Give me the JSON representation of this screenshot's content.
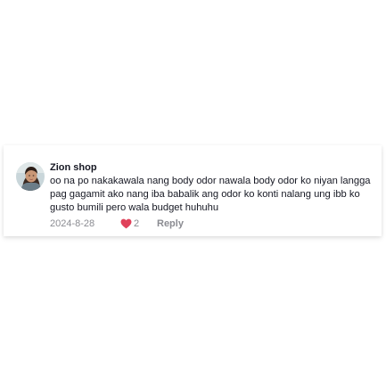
{
  "comment": {
    "username": "Zion shop",
    "text": "oo na po nakakawala nang body odor nawala body odor ko niyan langga pag gagamit ako nang iba babalik ang odor ko konti nalang ung ibb ko gusto bumili pero wala budget huhuhu",
    "date": "2024-8-28",
    "likes": "2",
    "reply_label": "Reply",
    "avatar_icon": "user-avatar-photo",
    "like_icon": "heart-icon"
  },
  "colors": {
    "heart": "#e0415a",
    "text": "#161823",
    "meta": "#8a8b91"
  }
}
